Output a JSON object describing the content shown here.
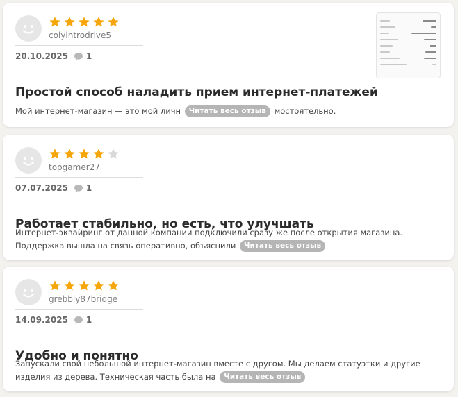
{
  "colors": {
    "star_filled": "#f6a609",
    "star_empty": "#d9d9d9",
    "read_more_bg": "#b5b5b5"
  },
  "reviews": [
    {
      "username": "colyintrodrive5",
      "rating": 5,
      "date": "20.10.2025",
      "comment_count": "1",
      "title": "Простой способ наладить прием интернет-платежей",
      "excerpt": "Мой интернет-магазин — это мой личн",
      "excerpt_tail": "мостоятельно.",
      "read_more": "Читать весь отзыв",
      "has_thumbnail": true
    },
    {
      "username": "topgamer27",
      "rating": 4,
      "date": "07.07.2025",
      "comment_count": "1",
      "title": "Работает стабильно, но есть, что улучшать",
      "excerpt": "Интернет-эквайринг от данной компании подключили сразу же после открытия магазина. Поддержка вышла на связь оперативно, объяснили",
      "excerpt_tail": "",
      "read_more": "Читать весь отзыв",
      "has_thumbnail": false
    },
    {
      "username": "grebbly87bridge",
      "rating": 5,
      "date": "14.09.2025",
      "comment_count": "1",
      "title": "Удобно и понятно",
      "excerpt": "Запускали свой небольшой интернет-магазин вместе с другом. Мы делаем статуэтки и другие изделия из дерева. Техническая часть была на",
      "excerpt_tail": "",
      "read_more": "Читать весь отзыв",
      "has_thumbnail": false
    }
  ]
}
